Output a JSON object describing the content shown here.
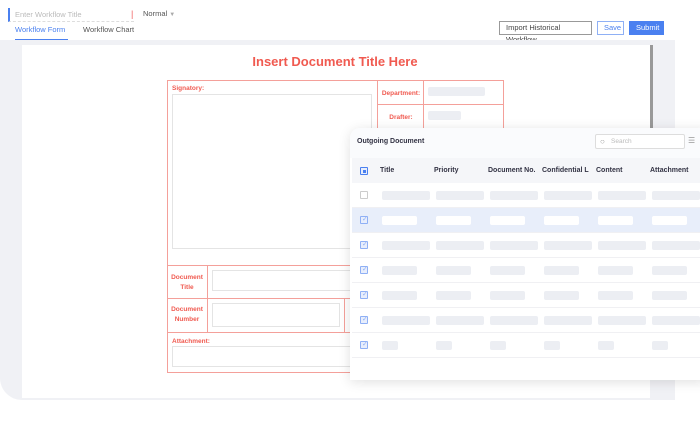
{
  "header": {
    "title_placeholder": "Enter Workflow Title",
    "priority": "Normal",
    "tabs": [
      {
        "label": "Workflow Form",
        "active": true
      },
      {
        "label": "Workflow Chart",
        "active": false
      }
    ],
    "buttons": {
      "import": "Import Historical Workflow",
      "save": "Save",
      "submit": "Submit"
    }
  },
  "colors": {
    "accent": "#4a80f0",
    "form_red": "#f05a50",
    "selected_row": "#e8eefa"
  },
  "form": {
    "title": "Insert Document Title Here",
    "signatory": "Signatory:",
    "department": "Department:",
    "drafter": "Drafter:",
    "document_title": "Document Title",
    "document_number": "Document Number",
    "attachment": "Attachment:"
  },
  "panel": {
    "title": "Outgoing Document",
    "search_placeholder": "Search",
    "columns": [
      "Title",
      "Priority",
      "Document No.",
      "Confidential L",
      "Content",
      "Attachment"
    ],
    "rows": [
      {
        "checked": false,
        "selected": false
      },
      {
        "checked": true,
        "selected": true
      },
      {
        "checked": true,
        "selected": false
      },
      {
        "checked": true,
        "selected": false
      },
      {
        "checked": true,
        "selected": false
      },
      {
        "checked": true,
        "selected": false
      },
      {
        "checked": true,
        "selected": false
      }
    ]
  }
}
